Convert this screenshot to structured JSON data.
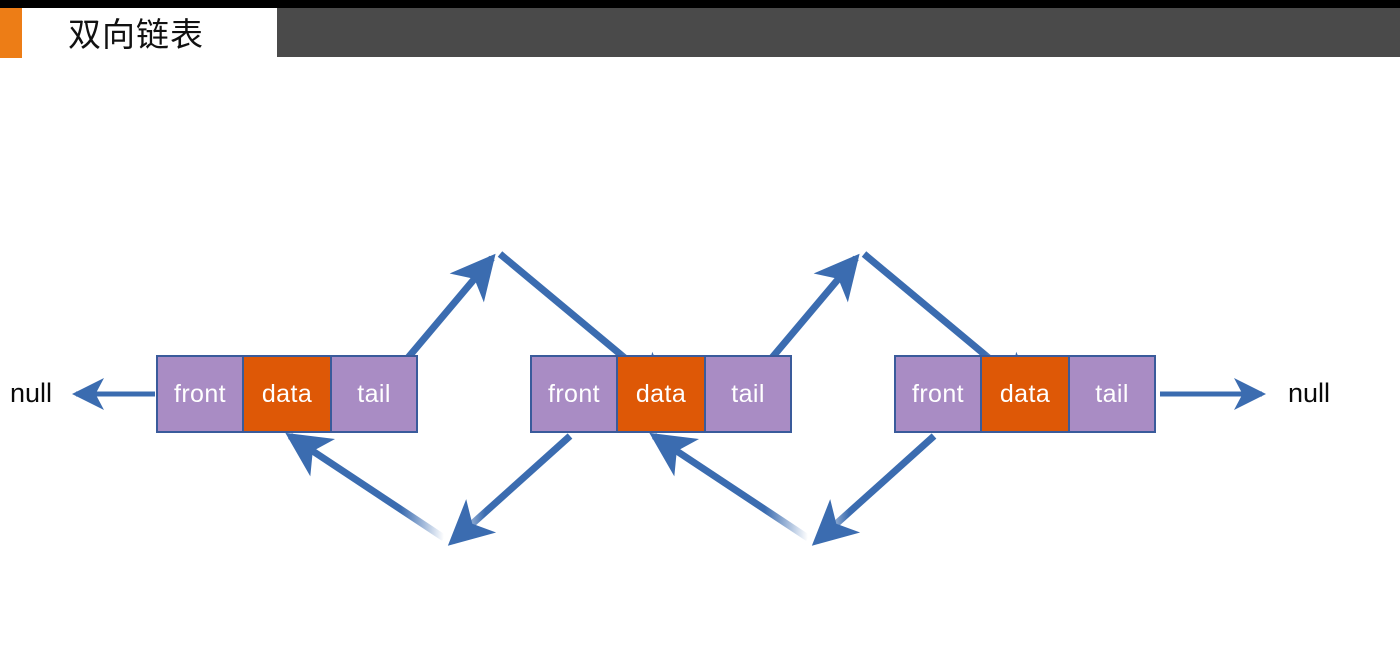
{
  "header": {
    "title": "双向链表",
    "accent_color": "#ED7D16",
    "panel_color": "#4A4A4A",
    "strip_color": "#000000"
  },
  "diagram": {
    "type": "doubly-linked-list",
    "colors": {
      "pointer_cell": "#A98CC4",
      "data_cell": "#DE5806",
      "cell_border": "#3A5B9B",
      "arrow": "#3B6CB0",
      "text": "#FFFFFF"
    },
    "terminators": {
      "left_label": "null",
      "right_label": "null"
    },
    "cell_labels": {
      "front": "front",
      "data": "data",
      "tail": "tail"
    },
    "nodes": [
      {
        "id": "node-1",
        "front": "front",
        "data": "data",
        "tail": "tail"
      },
      {
        "id": "node-2",
        "front": "front",
        "data": "data",
        "tail": "tail"
      },
      {
        "id": "node-3",
        "front": "front",
        "data": "data",
        "tail": "tail"
      }
    ],
    "links": [
      {
        "id": "head-null-link",
        "from": "node-1.front",
        "to": "null-left",
        "direction": "left"
      },
      {
        "id": "forward-link-1",
        "from": "node-1.tail",
        "to": "node-2.data",
        "direction": "right"
      },
      {
        "id": "backward-link-1",
        "from": "node-2.front",
        "to": "node-1.data",
        "direction": "left"
      },
      {
        "id": "forward-link-2",
        "from": "node-2.tail",
        "to": "node-3.data",
        "direction": "right"
      },
      {
        "id": "backward-link-2",
        "from": "node-3.front",
        "to": "node-2.data",
        "direction": "left"
      },
      {
        "id": "tail-null-link",
        "from": "node-3.tail",
        "to": "null-right",
        "direction": "right"
      }
    ]
  }
}
